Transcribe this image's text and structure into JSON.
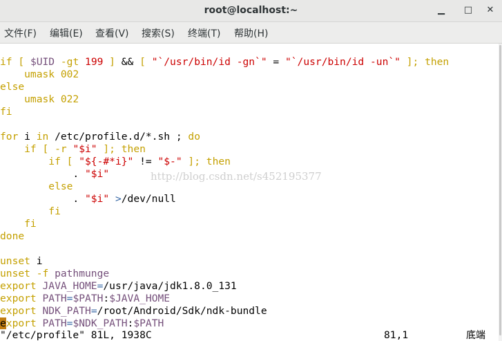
{
  "window": {
    "title": "root@localhost:~",
    "minimize_glyph": "▁",
    "maximize_glyph": "□",
    "close_glyph": "✕"
  },
  "menu": [
    {
      "label": "文件(F)"
    },
    {
      "label": "编辑(E)"
    },
    {
      "label": "查看(V)"
    },
    {
      "label": "搜索(S)"
    },
    {
      "label": "终端(T)"
    },
    {
      "label": "帮助(H)"
    }
  ],
  "colors": {
    "keyword": "#c4a000",
    "string": "#cc0000",
    "variable": "#75507b",
    "operator": "#3465a4",
    "plain": "#000000",
    "cursor": "#c17d11"
  },
  "terminal_lines": [
    [
      [
        "if [ ",
        "keyword"
      ],
      [
        "$UID",
        "variable"
      ],
      [
        " -gt ",
        "keyword"
      ],
      [
        "199",
        "string"
      ],
      [
        " ] ",
        "keyword"
      ],
      [
        "&& ",
        "plain"
      ],
      [
        "[ ",
        "keyword"
      ],
      [
        "\"`/usr/bin/id -gn`\"",
        "string"
      ],
      [
        " = ",
        "plain"
      ],
      [
        "\"`/usr/bin/id -un`\"",
        "string"
      ],
      [
        " ]; ",
        "keyword"
      ],
      [
        "then",
        "keyword"
      ]
    ],
    [
      [
        "    umask 002",
        "keyword"
      ]
    ],
    [
      [
        "else",
        "keyword"
      ]
    ],
    [
      [
        "    umask 022",
        "keyword"
      ]
    ],
    [
      [
        "fi",
        "keyword"
      ]
    ],
    [
      [
        "",
        ""
      ]
    ],
    [
      [
        "for ",
        "keyword"
      ],
      [
        "i",
        "plain"
      ],
      [
        " in ",
        "keyword"
      ],
      [
        "/etc/profile.d/*.sh ",
        "plain"
      ],
      [
        "; ",
        "plain"
      ],
      [
        "do",
        "keyword"
      ]
    ],
    [
      [
        "    if [ -r ",
        "keyword"
      ],
      [
        "\"$i\"",
        "string"
      ],
      [
        " ]; ",
        "keyword"
      ],
      [
        "then",
        "keyword"
      ]
    ],
    [
      [
        "        if [ ",
        "keyword"
      ],
      [
        "\"${-#*i}\"",
        "string"
      ],
      [
        " != ",
        "plain"
      ],
      [
        "\"$-\"",
        "string"
      ],
      [
        " ]; ",
        "keyword"
      ],
      [
        "then",
        "keyword"
      ]
    ],
    [
      [
        "            . ",
        "plain"
      ],
      [
        "\"$i\"",
        "string"
      ]
    ],
    [
      [
        "        else",
        "keyword"
      ]
    ],
    [
      [
        "            . ",
        "plain"
      ],
      [
        "\"$i\"",
        "string"
      ],
      [
        " >",
        "operator"
      ],
      [
        "/dev/null",
        "plain"
      ]
    ],
    [
      [
        "        fi",
        "keyword"
      ]
    ],
    [
      [
        "    fi",
        "keyword"
      ]
    ],
    [
      [
        "done",
        "keyword"
      ]
    ],
    [
      [
        "",
        ""
      ]
    ],
    [
      [
        "unset ",
        "keyword"
      ],
      [
        "i",
        "plain"
      ]
    ],
    [
      [
        "unset -f ",
        "keyword"
      ],
      [
        "pathmunge",
        "variable"
      ]
    ],
    [
      [
        "export ",
        "keyword"
      ],
      [
        "JAVA_HOME",
        "variable"
      ],
      [
        "=",
        "operator"
      ],
      [
        "/usr/java/jdk1.8.0_131",
        "plain"
      ]
    ],
    [
      [
        "export ",
        "keyword"
      ],
      [
        "PATH",
        "variable"
      ],
      [
        "=",
        "operator"
      ],
      [
        "$PATH",
        "variable"
      ],
      [
        ":",
        "plain"
      ],
      [
        "$JAVA_HOME",
        "variable"
      ]
    ],
    [
      [
        "export ",
        "keyword"
      ],
      [
        "NDK_PATH",
        "variable"
      ],
      [
        "=",
        "operator"
      ],
      [
        "/root/Android/Sdk/ndk-bundle",
        "plain"
      ]
    ],
    [
      [
        "e",
        "cursor"
      ],
      [
        "xport ",
        "keyword"
      ],
      [
        "PATH",
        "variable"
      ],
      [
        "=",
        "operator"
      ],
      [
        "$NDK_PATH",
        "variable"
      ],
      [
        ":",
        "plain"
      ],
      [
        "$PATH",
        "variable"
      ]
    ]
  ],
  "status": {
    "file_info": "\"/etc/profile\" 81L, 1938C",
    "position": "81,1",
    "scroll": "底端"
  },
  "watermark": "http://blog.csdn.net/s452195377"
}
